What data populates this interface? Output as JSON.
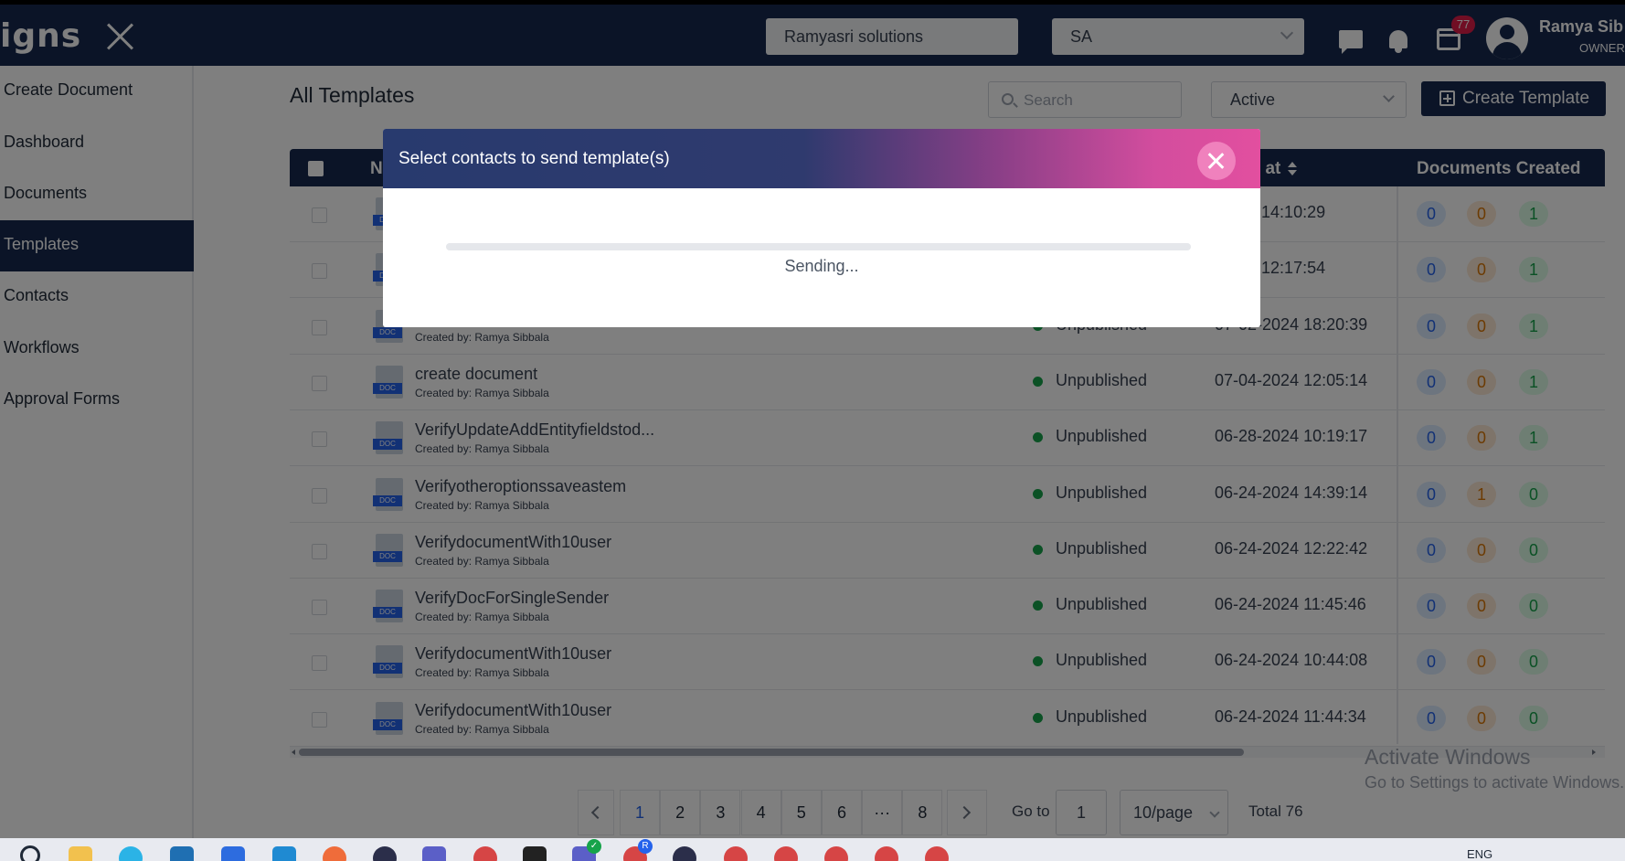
{
  "header": {
    "logo_text": "igns",
    "company": "Ramyasri solutions",
    "org_select": "SA",
    "notification_badge": "77",
    "user_name": "Ramya Sib",
    "user_role": "OWNER"
  },
  "sidebar": {
    "items": [
      {
        "label": "Create Document"
      },
      {
        "label": "Dashboard"
      },
      {
        "label": "Documents"
      },
      {
        "label": "Templates",
        "active": true
      },
      {
        "label": "Contacts"
      },
      {
        "label": "Workflows"
      },
      {
        "label": "Approval Forms"
      }
    ]
  },
  "main": {
    "title": "All Templates",
    "search_placeholder": "Search",
    "status_filter": "Active",
    "create_button": "Create Template"
  },
  "table": {
    "headers": {
      "name": "N",
      "created_at": "ed at",
      "documents_created": "Documents Created"
    },
    "doc_tag": "DOC",
    "rows": [
      {
        "name": "",
        "created_by": "",
        "status": "",
        "date": "-2024 14:10:29",
        "counts": [
          "0",
          "0",
          "1"
        ]
      },
      {
        "name": "",
        "created_by": "",
        "status": "",
        "date": "-2024 12:17:54",
        "counts": [
          "0",
          "0",
          "1"
        ]
      },
      {
        "name": "",
        "created_by": "Created by: Ramya Sibbala",
        "status": "Unpublished",
        "date": "07-02-2024 18:20:39",
        "counts": [
          "0",
          "0",
          "1"
        ]
      },
      {
        "name": "create document",
        "created_by": "Created by: Ramya Sibbala",
        "status": "Unpublished",
        "date": "07-04-2024 12:05:14",
        "counts": [
          "0",
          "0",
          "1"
        ]
      },
      {
        "name": "VerifyUpdateAddEntityfieldstod...",
        "created_by": "Created by: Ramya Sibbala",
        "status": "Unpublished",
        "date": "06-28-2024 10:19:17",
        "counts": [
          "0",
          "0",
          "1"
        ]
      },
      {
        "name": "Verifyotheroptionssaveastem",
        "created_by": "Created by: Ramya Sibbala",
        "status": "Unpublished",
        "date": "06-24-2024 14:39:14",
        "counts": [
          "0",
          "1",
          "0"
        ]
      },
      {
        "name": "VerifydocumentWith10user",
        "created_by": "Created by: Ramya Sibbala",
        "status": "Unpublished",
        "date": "06-24-2024 12:22:42",
        "counts": [
          "0",
          "0",
          "0"
        ]
      },
      {
        "name": "VerifyDocForSingleSender",
        "created_by": "Created by: Ramya Sibbala",
        "status": "Unpublished",
        "date": "06-24-2024 11:45:46",
        "counts": [
          "0",
          "0",
          "0"
        ]
      },
      {
        "name": "VerifydocumentWith10user",
        "created_by": "Created by: Ramya Sibbala",
        "status": "Unpublished",
        "date": "06-24-2024 10:44:08",
        "counts": [
          "0",
          "0",
          "0"
        ]
      },
      {
        "name": "VerifydocumentWith10user",
        "created_by": "Created by: Ramya Sibbala",
        "status": "Unpublished",
        "date": "06-24-2024 11:44:34",
        "counts": [
          "0",
          "0",
          "0"
        ]
      }
    ]
  },
  "pagination": {
    "pages": [
      "1",
      "2",
      "3",
      "4",
      "5",
      "6",
      "···",
      "8"
    ],
    "active_page": "1",
    "goto_label": "Go to",
    "goto_value": "1",
    "per_page": "10/page",
    "total": "Total 76"
  },
  "watermark": {
    "title": "Activate Windows",
    "subtitle": "Go to Settings to activate Windows."
  },
  "taskbar": {
    "language": "ENG"
  },
  "modal": {
    "title": "Select contacts to send template(s)",
    "status": "Sending...",
    "progress": 0
  },
  "colors": {
    "primary": "#16294f",
    "status_published": "#16a34a",
    "modal_gradient_end": "#e24f9f"
  }
}
